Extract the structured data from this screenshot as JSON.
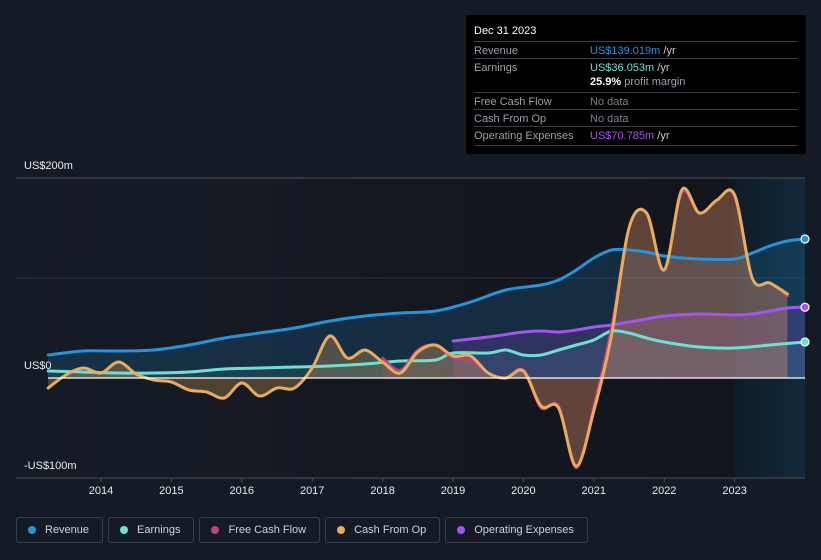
{
  "tooltip": {
    "date": "Dec 31 2023",
    "rows": [
      {
        "label": "Revenue",
        "value": "US$139.019m",
        "unit": " /yr",
        "color": "#2394df"
      },
      {
        "label": "Earnings",
        "value": "US$36.053m",
        "unit": " /yr",
        "color": "#6ee0d0"
      },
      {
        "label": "",
        "value": "25.9%",
        "unit": " profit margin",
        "color": "#ffffff"
      },
      {
        "label": "Free Cash Flow",
        "value": "No data",
        "unit": "",
        "color": "#7c8087"
      },
      {
        "label": "Cash From Op",
        "value": "No data",
        "unit": "",
        "color": "#7c8087"
      },
      {
        "label": "Operating Expenses",
        "value": "US$70.785m",
        "unit": " /yr",
        "color": "#a653f5"
      }
    ]
  },
  "legend": [
    {
      "label": "Revenue",
      "color": "#2394df"
    },
    {
      "label": "Earnings",
      "color": "#6ee0d0"
    },
    {
      "label": "Free Cash Flow",
      "color": "#c2417c"
    },
    {
      "label": "Cash From Op",
      "color": "#e8ac5c"
    },
    {
      "label": "Operating Expenses",
      "color": "#a653f5"
    }
  ],
  "chart_data": {
    "type": "line",
    "title": "",
    "xlabel": "",
    "ylabel": "",
    "ylim": [
      -100,
      200
    ],
    "xlim": [
      2013.25,
      2024.0
    ],
    "y_tick_labels": [
      "US$200m",
      "US$0",
      "-US$100m"
    ],
    "y_ticks": [
      200,
      100,
      0,
      -100
    ],
    "x_tick_labels": [
      "2014",
      "2015",
      "2016",
      "2017",
      "2018",
      "2019",
      "2020",
      "2021",
      "2022",
      "2023"
    ],
    "x_ticks": [
      2014,
      2015,
      2016,
      2017,
      2018,
      2019,
      2020,
      2021,
      2022,
      2023
    ],
    "grid": true,
    "legend_position": "bottom",
    "highlight_region": [
      2023.0,
      2024.0
    ],
    "series": [
      {
        "name": "Revenue",
        "color": "#2394df",
        "x": [
          2013.25,
          2013.75,
          2014.25,
          2014.75,
          2015.25,
          2015.75,
          2016.25,
          2016.75,
          2017.25,
          2017.75,
          2018.25,
          2018.75,
          2019.25,
          2019.75,
          2020.25,
          2020.5,
          2020.75,
          2021.0,
          2021.25,
          2021.5,
          2021.75,
          2022.0,
          2022.5,
          2023.0,
          2023.25,
          2023.5,
          2023.75,
          2024.0
        ],
        "y": [
          23,
          27,
          27,
          28,
          33,
          40,
          45,
          50,
          57,
          62,
          65,
          67,
          76,
          88,
          93,
          98,
          108,
          120,
          128,
          128,
          126,
          122,
          119,
          119,
          125,
          132,
          137,
          139.019
        ]
      },
      {
        "name": "Earnings",
        "color": "#6ee0d0",
        "x": [
          2013.25,
          2013.75,
          2014.25,
          2014.75,
          2015.25,
          2015.75,
          2016.25,
          2016.75,
          2017.25,
          2017.75,
          2018.25,
          2018.75,
          2019.0,
          2019.5,
          2019.75,
          2020.0,
          2020.25,
          2020.5,
          2020.75,
          2021.0,
          2021.25,
          2021.5,
          2021.75,
          2022.0,
          2022.5,
          2023.0,
          2023.5,
          2024.0
        ],
        "y": [
          7,
          6,
          5,
          5,
          6,
          9,
          10,
          11,
          12,
          14,
          17,
          18,
          25,
          25,
          28,
          23,
          23,
          28,
          33,
          38,
          47,
          45,
          40,
          36,
          31,
          30,
          33,
          36.053
        ]
      },
      {
        "name": "Free Cash Flow",
        "color": "#c2417c",
        "x": [
          2018.0,
          2018.25,
          2018.5,
          2018.75,
          2019.0,
          2019.25,
          2019.5,
          2019.75,
          2020.0,
          2020.25,
          2020.5,
          2020.75,
          2021.0,
          2021.25,
          2021.5,
          2021.75,
          2022.0,
          2022.25,
          2022.5,
          2022.75,
          2023.0,
          2023.25,
          2023.5,
          2023.75
        ],
        "y": [
          20,
          8,
          28,
          33,
          20,
          18,
          5,
          0,
          8,
          -30,
          -28,
          -90,
          -28,
          50,
          150,
          165,
          108,
          185,
          165,
          178,
          182,
          100,
          95,
          82
        ]
      },
      {
        "name": "Cash From Op",
        "color": "#e8ac5c",
        "x": [
          2013.25,
          2013.5,
          2013.75,
          2014.0,
          2014.25,
          2014.5,
          2014.75,
          2015.0,
          2015.25,
          2015.5,
          2015.75,
          2016.0,
          2016.25,
          2016.5,
          2016.75,
          2017.0,
          2017.25,
          2017.5,
          2017.75,
          2018.0,
          2018.25,
          2018.5,
          2018.75,
          2019.0,
          2019.25,
          2019.5,
          2019.75,
          2020.0,
          2020.25,
          2020.5,
          2020.75,
          2021.0,
          2021.25,
          2021.5,
          2021.75,
          2022.0,
          2022.25,
          2022.5,
          2022.75,
          2023.0,
          2023.25,
          2023.5,
          2023.75
        ],
        "y": [
          -10,
          3,
          10,
          5,
          16,
          4,
          -2,
          -4,
          -12,
          -14,
          -20,
          -5,
          -18,
          -10,
          -10,
          10,
          42,
          20,
          28,
          16,
          5,
          26,
          33,
          22,
          22,
          5,
          0,
          7,
          -28,
          -30,
          -88,
          -33,
          42,
          150,
          165,
          108,
          188,
          165,
          178,
          183,
          100,
          95,
          84
        ]
      },
      {
        "name": "Operating Expenses",
        "color": "#a653f5",
        "x": [
          2019.0,
          2019.5,
          2020.0,
          2020.25,
          2020.5,
          2020.75,
          2021.0,
          2021.25,
          2021.5,
          2021.75,
          2022.0,
          2022.5,
          2023.0,
          2023.25,
          2023.5,
          2023.75,
          2024.0
        ],
        "y": [
          37,
          41,
          46,
          47,
          46,
          48,
          51,
          53,
          56,
          59,
          62,
          64,
          63,
          64,
          67,
          70,
          70.785
        ]
      }
    ]
  }
}
